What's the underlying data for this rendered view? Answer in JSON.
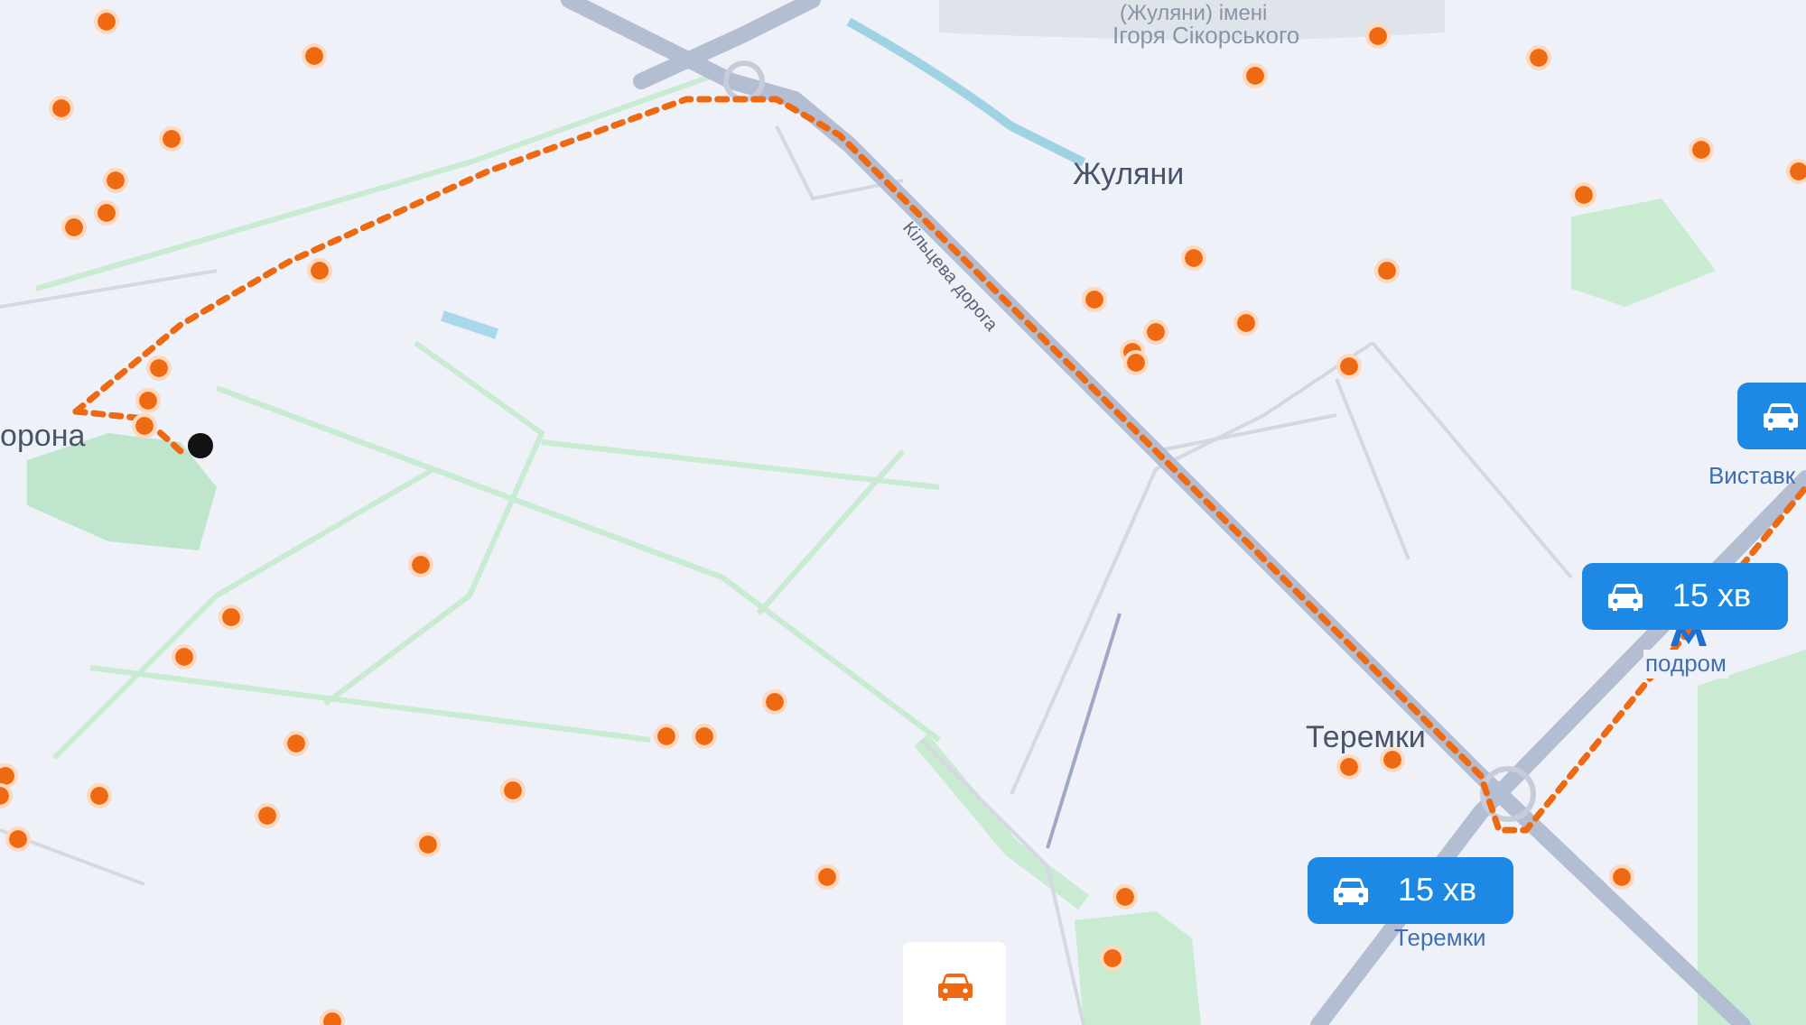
{
  "map": {
    "place_labels": [
      {
        "text": "(Жуляни) імені"
      },
      {
        "text": "Ігоря Сікорського"
      },
      {
        "text": "Жуляни"
      },
      {
        "text": "орона"
      },
      {
        "text": "Виставк"
      },
      {
        "text": "подром"
      },
      {
        "text": "Теремки"
      },
      {
        "text": "Теремки"
      }
    ],
    "road_labels": [
      {
        "text": "Кільцева дорога"
      }
    ],
    "route_badges": [
      {
        "kind": "icon"
      },
      {
        "kind": "timed",
        "time": "15 хв"
      },
      {
        "kind": "timed",
        "time": "15 хв"
      }
    ],
    "transport_button": {
      "selected": true
    }
  }
}
